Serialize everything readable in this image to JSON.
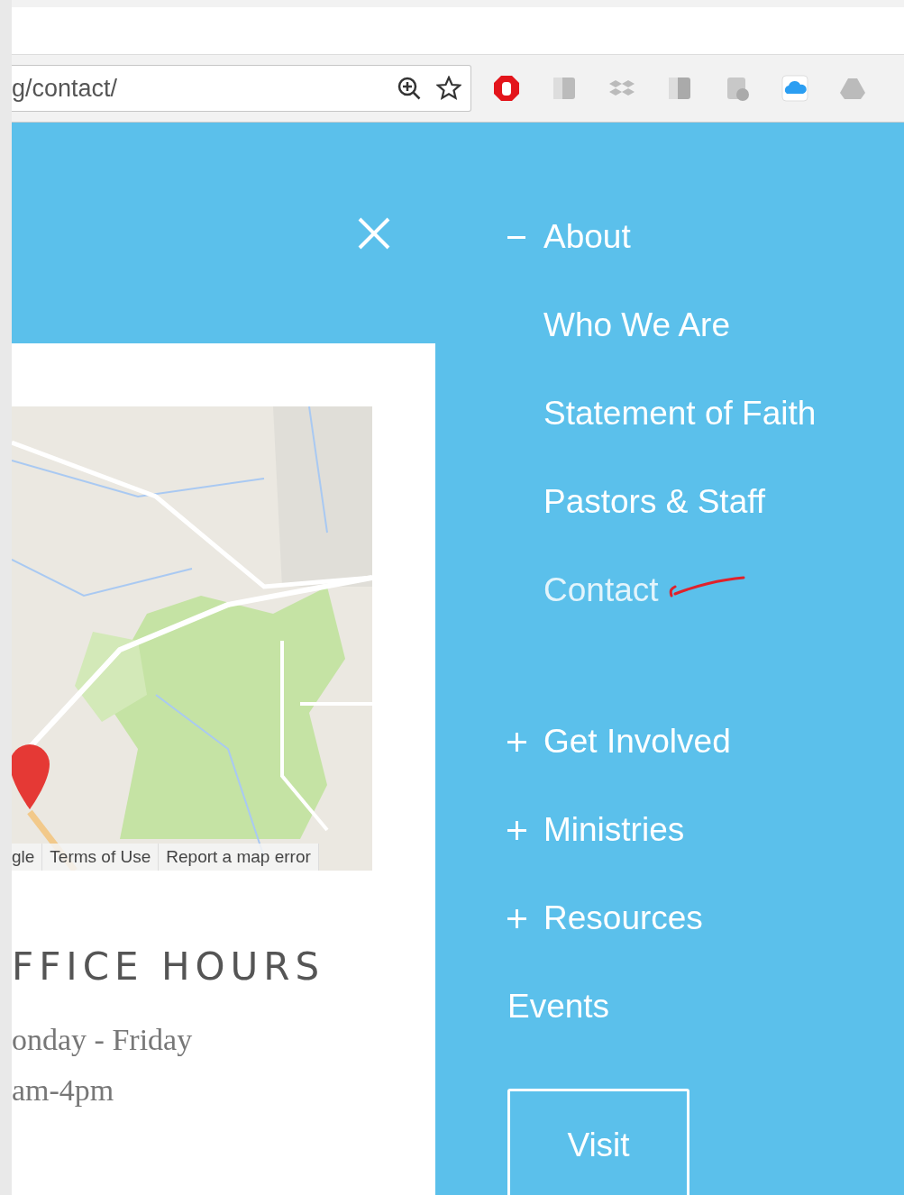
{
  "browser": {
    "url": "g/contact/"
  },
  "card": {
    "map": {
      "kind": "picture",
      "attribution": [
        "gle",
        "Terms of Use",
        "Report a map error"
      ]
    },
    "heading": "FFICE HOURS",
    "lines": [
      "onday - Friday",
      "am-4pm"
    ]
  },
  "menu": {
    "items": [
      {
        "label": "About",
        "kind": "toggle",
        "expanded": true,
        "children": [
          {
            "label": "Who We Are",
            "selected": false
          },
          {
            "label": "Statement of Faith",
            "selected": false
          },
          {
            "label": "Pastors & Staff",
            "selected": false
          },
          {
            "label": "Contact",
            "selected": true
          }
        ]
      },
      {
        "label": "Get Involved",
        "kind": "toggle",
        "expanded": false
      },
      {
        "label": "Ministries",
        "kind": "toggle",
        "expanded": false
      },
      {
        "label": "Resources",
        "kind": "toggle",
        "expanded": false
      },
      {
        "label": "Events",
        "kind": "link"
      }
    ],
    "button": "Visit"
  }
}
